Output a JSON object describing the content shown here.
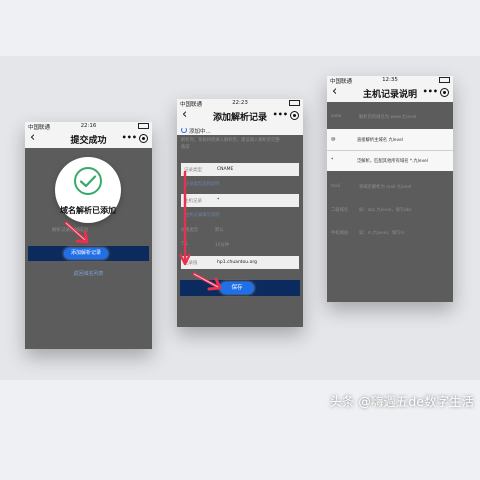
{
  "phone1": {
    "status": {
      "carrier": "中国联通",
      "time": "22:16",
      "battery": ""
    },
    "title": "提交成功",
    "success_text": "域名解析已添加",
    "faded_line": "解析记录添加成功",
    "primary_button": "添加解析记录",
    "link": "返回域名列表"
  },
  "phone2": {
    "status": {
      "carrier": "中国联通",
      "time": "22:23",
      "battery": ""
    },
    "title": "添加解析记录",
    "loading": "添加中...",
    "hint_lines": [
      "解析时，系统将把填入解析后，建议填入解析的完整",
      "备案"
    ],
    "fields": [
      {
        "label": "记录类型",
        "value": "CNAME"
      },
      {
        "label": "主机记录",
        "value": "*"
      },
      {
        "label": "记录值",
        "value": "hp1.chuantou.org"
      }
    ],
    "dim_links": [
      "记录类型选择说明",
      "主机记录填写说明"
    ],
    "dim_rows": [
      {
        "label": "线路类型",
        "value": "默认"
      },
      {
        "label": "TTL",
        "value": "10分钟"
      }
    ],
    "save_button": "保存"
  },
  "phone3": {
    "status": {
      "carrier": "中国联通",
      "time": "12:35",
      "battery": ""
    },
    "title": "主机记录说明",
    "dim_top": {
      "label": "www",
      "value": "解析后的域名为 www.九level"
    },
    "highlight_rows": [
      {
        "label": "@",
        "value": "直接解析主域名 九level"
      },
      {
        "label": "*",
        "value": "泛解析，匹配其他所有域名 *.九level"
      }
    ],
    "dim_rows": [
      {
        "label": "mail",
        "value": "将域名解析为 mail.九level"
      },
      {
        "label": "二级域名",
        "value": "如：abc.九level，填写abc"
      },
      {
        "label": "手机网站",
        "value": "如：m.九level，填写m"
      }
    ]
  },
  "watermark": "头条 @嗨週五de数字生活",
  "colors": {
    "screen_dim": "#5c5c5c",
    "navy": "#0b2a5e",
    "blue": "#1f6fe8",
    "arrow": "#e8304f",
    "green": "#39a96b"
  }
}
